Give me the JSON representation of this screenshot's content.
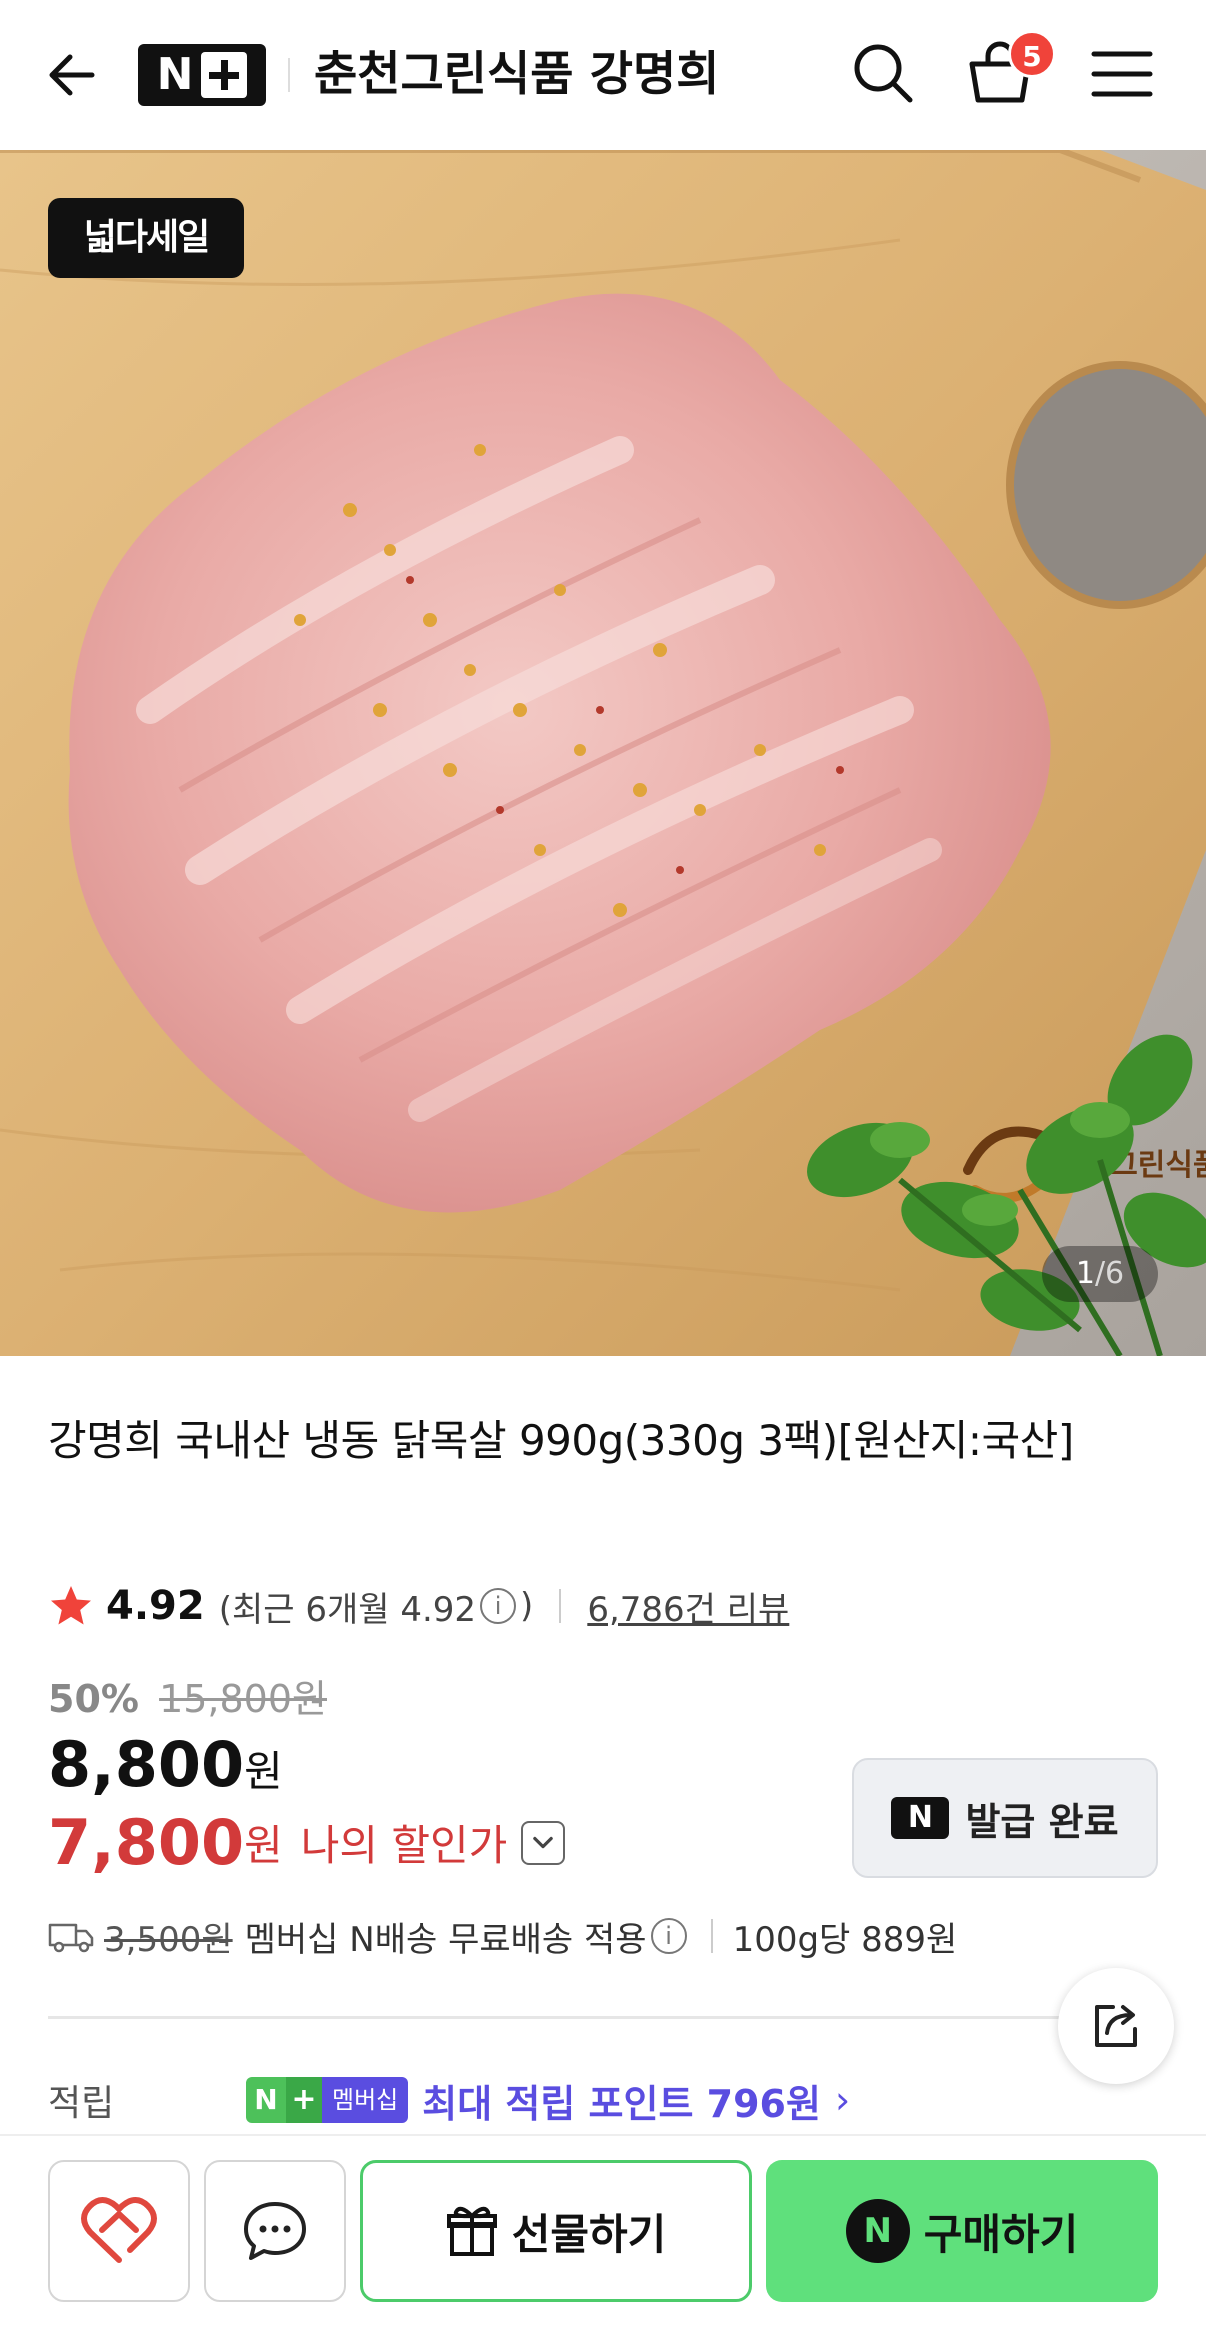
{
  "header": {
    "back_icon": "arrow-left-icon",
    "logo_n": "N",
    "store_name": "춘천그린식품 강명희",
    "search_icon": "search-icon",
    "cart_icon": "shopping-bag-icon",
    "cart_count": "5",
    "menu_icon": "hamburger-menu-icon"
  },
  "hero": {
    "sale_badge": "넓다세일",
    "pager_current": "1",
    "pager_total": "/6",
    "board_logo_text": "춘천그린식품"
  },
  "product": {
    "title": "강명희 국내산 냉동 닭목살 990g(330g 3팩)[원산지:국산]",
    "rating": "4.92",
    "rating_recent_prefix": "(최근 6개월 4.92",
    "rating_recent_suffix": ")",
    "review_count": "6,786건 리뷰",
    "discount_pct": "50%",
    "original_price": "15,800원",
    "price": "8,800",
    "price_unit": "원",
    "my_price": "7,800",
    "my_price_unit": "원",
    "my_price_label": "나의 할인가"
  },
  "coupon": {
    "badge": "N",
    "label": "발급 완료"
  },
  "shipping": {
    "original_fee": "3,500원",
    "note": "멤버십 N배송 무료배송 적용",
    "unit_price": "100g당 889원"
  },
  "points": {
    "label": "적립",
    "badge_n": "N",
    "badge_plus": "+",
    "badge_text": "멤버십",
    "text": "최대 적립 포인트 796원",
    "chevron": "›"
  },
  "bottom_bar": {
    "gift_label": "선물하기",
    "buy_badge": "N",
    "buy_label": "구매하기"
  },
  "colors": {
    "accent_green": "#5fe07c",
    "price_red": "#d23a3a",
    "points_purple": "#5a4de0",
    "badge_red": "#f0433a"
  }
}
